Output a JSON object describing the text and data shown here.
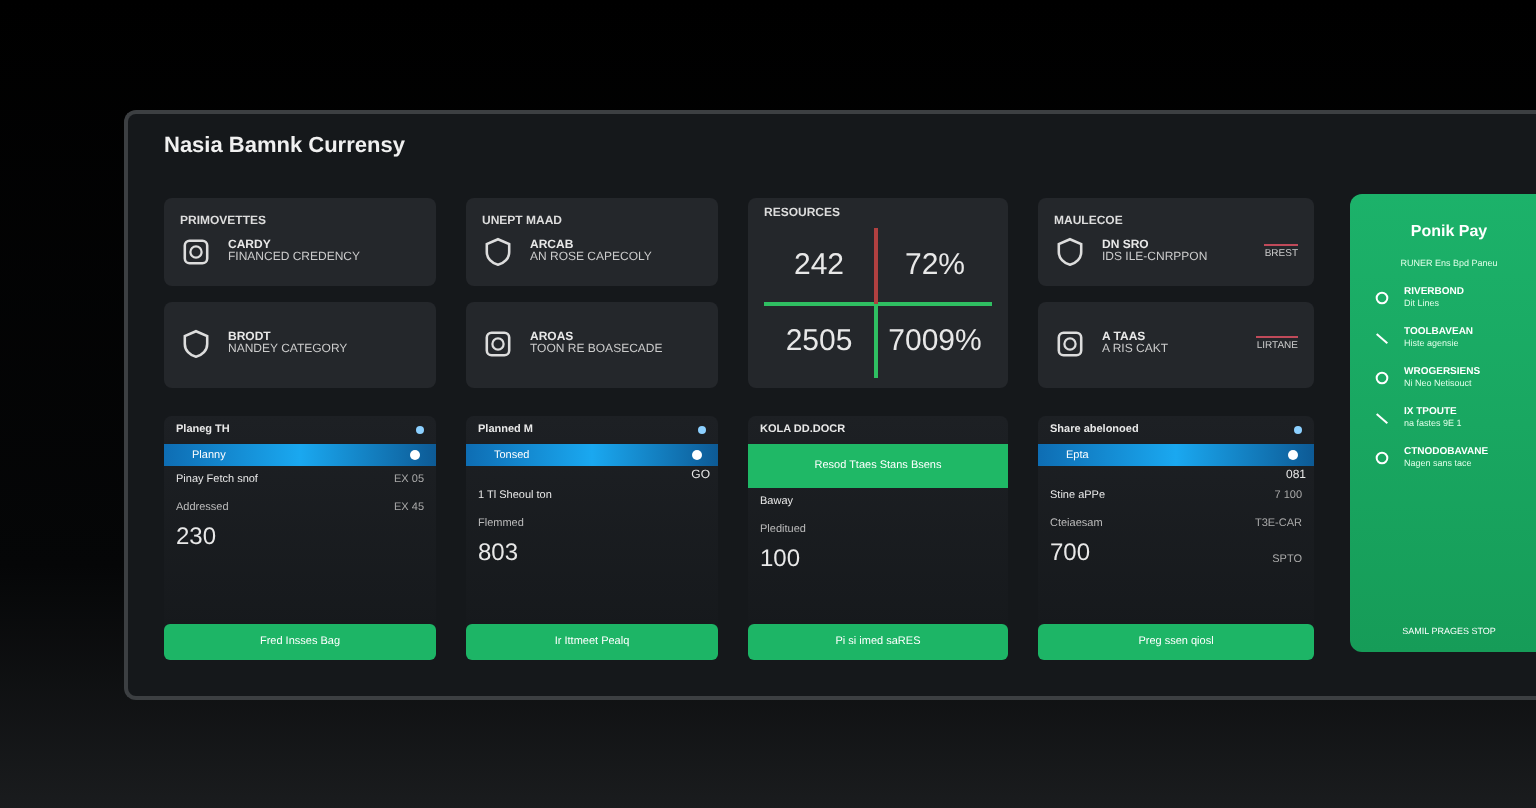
{
  "title": "Nasia Bamnk Currensy",
  "columns": [
    {
      "tiles": [
        {
          "kind": "info",
          "heading": "PRIMOVETTES",
          "name": "CARDY",
          "detail": "FINANCED CREDENCY"
        },
        {
          "kind": "info",
          "name": "BRODT",
          "detail": "NANDEY CATEGORY"
        }
      ],
      "panel": {
        "heading": "Planeg TH",
        "bar": {
          "kind": "blue",
          "label": "Planny"
        },
        "row_label": "Pinay Fetch snof",
        "row_value": "EX 05",
        "caption": "Addressed",
        "caption_value": "EX 45",
        "amount": "230",
        "button": "Fred Insses Bag"
      }
    },
    {
      "tiles": [
        {
          "kind": "info",
          "heading": "UNEPT MAAD",
          "name": "ARCAB",
          "detail": "AN ROSE CAPECOLY"
        },
        {
          "kind": "info",
          "name": "AROAS",
          "detail": "TOON RE BOASECADE"
        }
      ],
      "panel": {
        "heading": "Planned M",
        "bar": {
          "kind": "blue",
          "label": "Tonsed"
        },
        "note": "GO",
        "row_label": "1 Tl Sheoul ton",
        "caption": "Flemmed",
        "amount": "803",
        "button": "Ir Ittmeet Pealq"
      }
    },
    {
      "tiles": [
        {
          "kind": "stats",
          "heading": "RESOURCES",
          "values": [
            "242",
            "72%",
            "2505",
            "7009%"
          ]
        }
      ],
      "panel": {
        "heading": "KOLA DD.DOCR",
        "bar": {
          "kind": "green",
          "label": "Resod Ttaes Stans Bsens"
        },
        "row_label": "Baway",
        "caption": "Pleditued",
        "amount": "100",
        "button": "Pi si imed saRES"
      }
    },
    {
      "tiles": [
        {
          "kind": "info",
          "heading": "MAULECOE",
          "name": "DN SRO",
          "detail": "IDS ILE-CNRPPON",
          "aside": "BREST"
        },
        {
          "kind": "info",
          "name": "A TAAS",
          "detail": "A RIS CAKT",
          "aside": "LIRTANE"
        }
      ],
      "panel": {
        "heading": "Share abelonoed",
        "bar": {
          "kind": "blue",
          "label": "Epta"
        },
        "note": "081",
        "row_label": "Stine aPPe",
        "row_value": "7 100",
        "caption": "Cteiaesam",
        "caption_value": "T3E-CAR",
        "amount": "700",
        "amount_side": "SPTO",
        "button": "Preg ssen qiosl"
      }
    }
  ],
  "side_panel": {
    "title": "Ponik Pay",
    "subtitle": "RUNER Ens Bpd Paneu",
    "items": [
      {
        "name": "RIVERBOND",
        "sub": "Dit Lines"
      },
      {
        "name": "TOOLBAVEAN",
        "sub": "Histe agensie"
      },
      {
        "name": "WROGERSIENS",
        "sub": "Ni Neo Netisouct"
      },
      {
        "name": "IX TPOUTE",
        "sub": "na fastes 9E 1"
      },
      {
        "name": "CTNODOBAVANE",
        "sub": "Nagen sans tace"
      }
    ],
    "footer": "SAMIL PRAGES STOP"
  }
}
